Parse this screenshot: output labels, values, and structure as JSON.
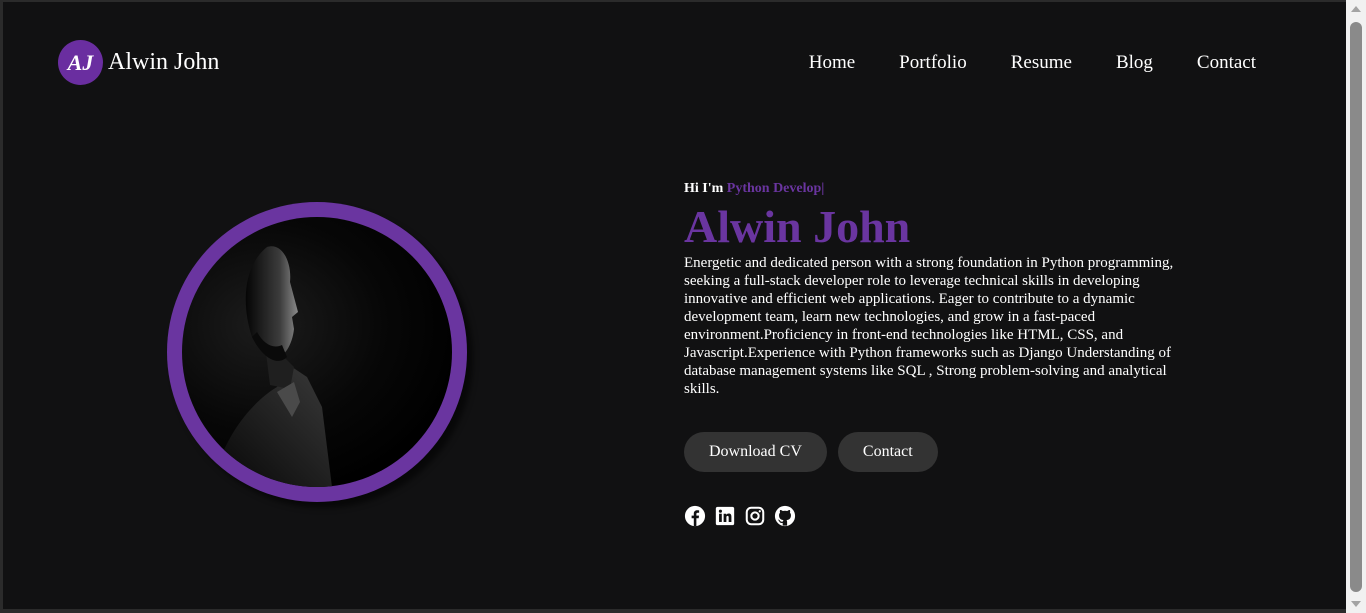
{
  "header": {
    "logo_initials": "AJ",
    "logo_name": "Alwin John",
    "nav": [
      "Home",
      "Portfolio",
      "Resume",
      "Blog",
      "Contact"
    ]
  },
  "hero": {
    "intro_prefix": "Hi I'm",
    "intro_role": "Python Develop|",
    "name": "Alwin John",
    "bio": "Energetic and dedicated person with a strong foundation in Python programming, seeking a full-stack developer role to leverage technical skills in developing innovative and efficient web applications. Eager to contribute to a dynamic development team, learn new technologies, and grow in a fast-paced environment.Proficiency in front-end technologies like HTML, CSS, and Javascript.Experience with Python frameworks such as Django Understanding of database management systems like SQL , Strong problem-solving and analytical skills.",
    "buttons": {
      "download": "Download CV",
      "contact": "Contact"
    },
    "socials": [
      "facebook-icon",
      "linkedin-icon",
      "instagram-icon",
      "github-icon"
    ]
  },
  "colors": {
    "accent": "#6a35a0",
    "background": "#111112",
    "button": "#333333"
  }
}
